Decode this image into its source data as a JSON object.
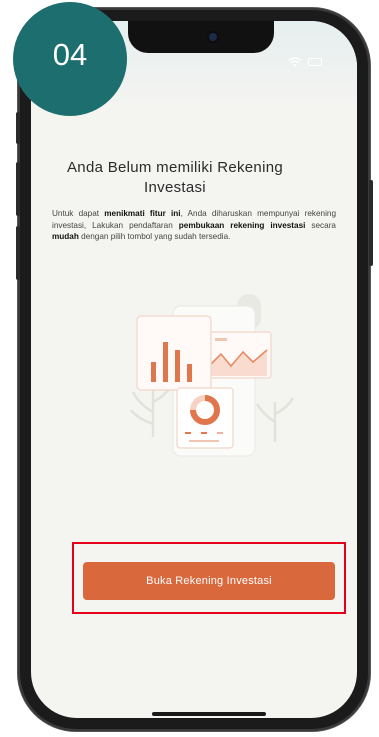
{
  "step_badge": "04",
  "page": {
    "title": "Anda Belum memiliki Rekening Investasi",
    "description": {
      "p1": "Untuk dapat ",
      "b1": "menikmati fitur ini",
      "p2": ", Anda diharuskan mempunyai rekening investasi, Lakukan pendaftaran ",
      "b2": "pembukaan rekening investasi",
      "p3": " secara ",
      "b3": "mudah",
      "p4": " dengan pilih tombol yang sudah tersedia."
    }
  },
  "cta": {
    "label": "Buka Rekening Investasi"
  },
  "colors": {
    "badge": "#1d6e6e",
    "cta": "#d9683c",
    "highlight_outline": "#e4001b",
    "screen_bg": "#f4f4f1"
  },
  "icons": [
    "wifi-icon",
    "battery-icon",
    "investment-illustration"
  ]
}
